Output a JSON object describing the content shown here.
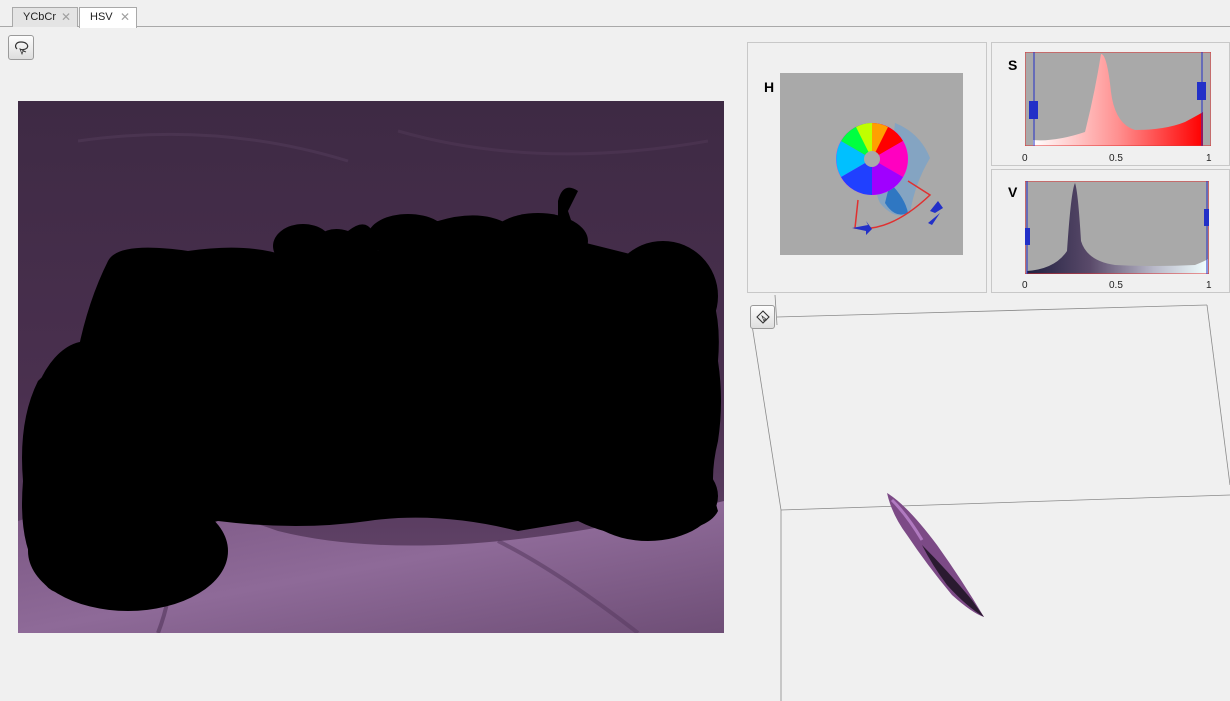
{
  "tabs": [
    {
      "label": "YCbCr",
      "active": false
    },
    {
      "label": "HSV",
      "active": true
    }
  ],
  "toolbar": {
    "main_tool_icon": "lasso-select-icon",
    "cloud_tool_icon": "rotate-point-cloud-icon"
  },
  "hue_panel": {
    "label": "H"
  },
  "saturation_panel": {
    "label": "S",
    "ticks": [
      "0",
      "0.5",
      "1"
    ],
    "range": [
      0.05,
      0.98
    ]
  },
  "value_panel": {
    "label": "V",
    "ticks": [
      "0",
      "0.5",
      "1"
    ],
    "range": [
      0.02,
      0.99
    ]
  },
  "colors": {
    "accent_blue": "#2230c8",
    "selection_red": "#e03030",
    "cloth_purple": "#5a3a5e"
  }
}
